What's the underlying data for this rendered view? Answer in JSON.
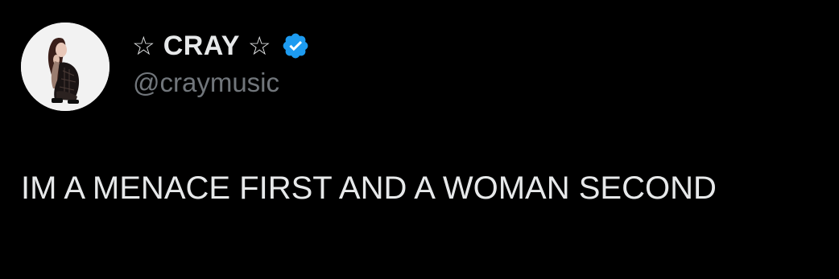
{
  "author": {
    "star_left": "☆",
    "display_name": "CRAY",
    "star_right": "☆",
    "verified_icon": "verified-badge-icon",
    "verified_color": "#1d9bf0",
    "handle": "@craymusic"
  },
  "tweet": {
    "text": "IM A MENACE FIRST AND A WOMAN SECOND"
  },
  "colors": {
    "background": "#000000",
    "primary_text": "#e7e9ea",
    "secondary_text": "#71767b"
  }
}
